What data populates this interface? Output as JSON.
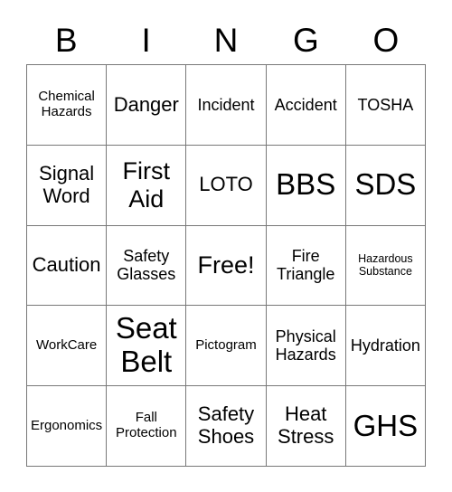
{
  "card": {
    "background_color": "#ffffff",
    "text_color": "#000000",
    "border_color": "#787878",
    "header": {
      "letters": [
        "B",
        "I",
        "N",
        "G",
        "O"
      ]
    },
    "grid": {
      "columns": 5,
      "rows": 5,
      "cells": [
        {
          "label": "Chemical\nHazards",
          "size": "s"
        },
        {
          "label": "Danger",
          "size": "l"
        },
        {
          "label": "Incident",
          "size": "m"
        },
        {
          "label": "Accident",
          "size": "m"
        },
        {
          "label": "TOSHA",
          "size": "m"
        },
        {
          "label": "Signal\nWord",
          "size": "l"
        },
        {
          "label": "First\nAid",
          "size": "xl"
        },
        {
          "label": "LOTO",
          "size": "l"
        },
        {
          "label": "BBS",
          "size": "xxl"
        },
        {
          "label": "SDS",
          "size": "xxl"
        },
        {
          "label": "Caution",
          "size": "l"
        },
        {
          "label": "Safety\nGlasses",
          "size": "m"
        },
        {
          "label": "Free!",
          "size": "xl"
        },
        {
          "label": "Fire\nTriangle",
          "size": "m"
        },
        {
          "label": "Hazardous\nSubstance",
          "size": "xs"
        },
        {
          "label": "WorkCare",
          "size": "s"
        },
        {
          "label": "Seat\nBelt",
          "size": "xxl"
        },
        {
          "label": "Pictogram",
          "size": "s"
        },
        {
          "label": "Physical\nHazards",
          "size": "m"
        },
        {
          "label": "Hydration",
          "size": "m"
        },
        {
          "label": "Ergonomics",
          "size": "s"
        },
        {
          "label": "Fall\nProtection",
          "size": "s"
        },
        {
          "label": "Safety\nShoes",
          "size": "l"
        },
        {
          "label": "Heat\nStress",
          "size": "l"
        },
        {
          "label": "GHS",
          "size": "xxl"
        }
      ]
    }
  }
}
